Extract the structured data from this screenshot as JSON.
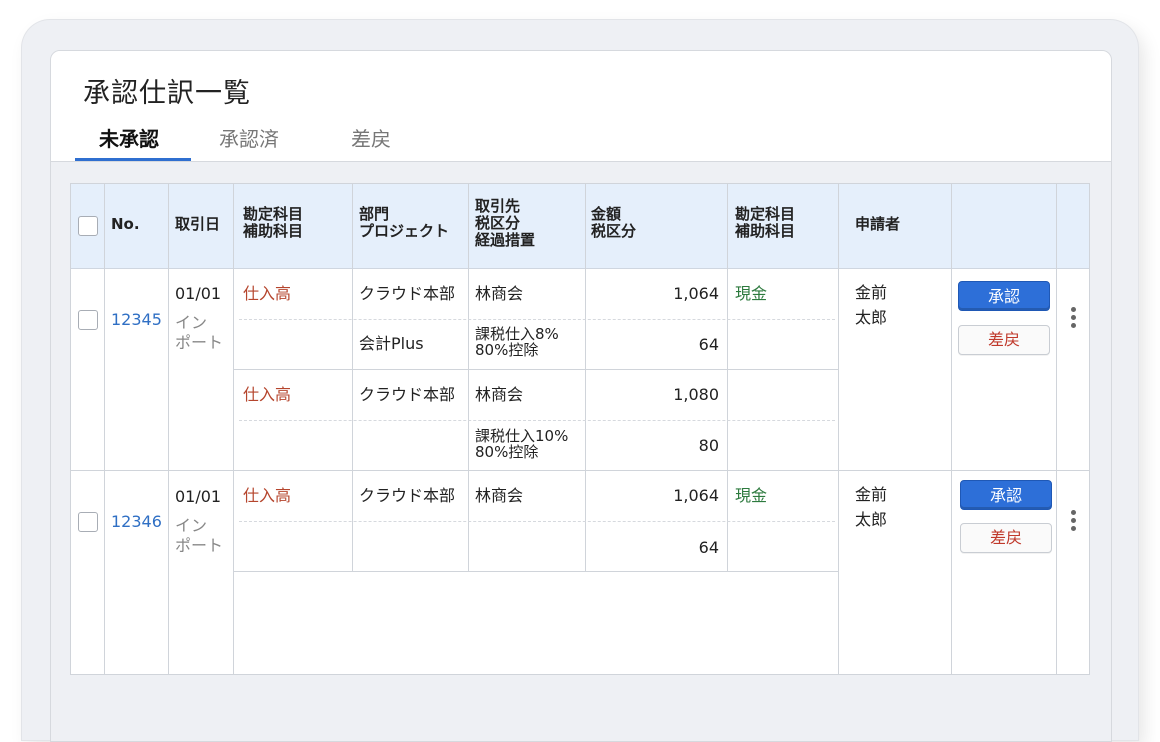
{
  "page": {
    "title": "承認仕訳一覧"
  },
  "tabs": [
    {
      "label": "未承認",
      "active": true
    },
    {
      "label": "承認済",
      "active": false
    },
    {
      "label": "差戻",
      "active": false
    }
  ],
  "table": {
    "headers": {
      "no": "No.",
      "date": "取引日",
      "account": [
        "勘定科目",
        "補助科目"
      ],
      "dept": [
        "部門",
        "プロジェクト"
      ],
      "partner": [
        "取引先",
        "税区分",
        "経過措置"
      ],
      "amount": [
        "金額",
        "税区分"
      ],
      "account2": [
        "勘定科目",
        "補助科目"
      ],
      "applicant": "申請者"
    },
    "entries": [
      {
        "no": "12345",
        "date": "01/01",
        "source": [
          "イン",
          "ポート"
        ],
        "lines": [
          {
            "account": "仕入高",
            "dept": "クラウド本部",
            "partner": "林商会",
            "amount": "1,064",
            "account2": "現金",
            "project": "会計Plus",
            "tax": [
              "課税仕入8%",
              "80%控除"
            ],
            "tax_amount": "64"
          },
          {
            "account": "仕入高",
            "dept": "クラウド本部",
            "partner": "林商会",
            "amount": "1,080",
            "account2": "",
            "project": "",
            "tax": [
              "課税仕入10%",
              "80%控除"
            ],
            "tax_amount": "80"
          }
        ],
        "applicant": [
          "金前",
          "太郎"
        ],
        "approve_label": "承認",
        "reject_label": "差戻"
      },
      {
        "no": "12346",
        "date": "01/01",
        "source": [
          "イン",
          "ポート"
        ],
        "lines": [
          {
            "account": "仕入高",
            "dept": "クラウド本部",
            "partner": "林商会",
            "amount": "1,064",
            "account2": "現金",
            "project": "",
            "tax": [
              "",
              ""
            ],
            "tax_amount": "64"
          }
        ],
        "applicant": [
          "金前",
          "太郎"
        ],
        "approve_label": "承認",
        "reject_label": "差戻"
      }
    ]
  },
  "colors": {
    "accent": "#2f6fd0",
    "header_bg": "#e5effb",
    "account_red": "#b5452d",
    "cash_green": "#2d7a3e",
    "link_blue": "#2f6fc4"
  },
  "icons": {
    "row_menu": "more-vertical-icon"
  }
}
